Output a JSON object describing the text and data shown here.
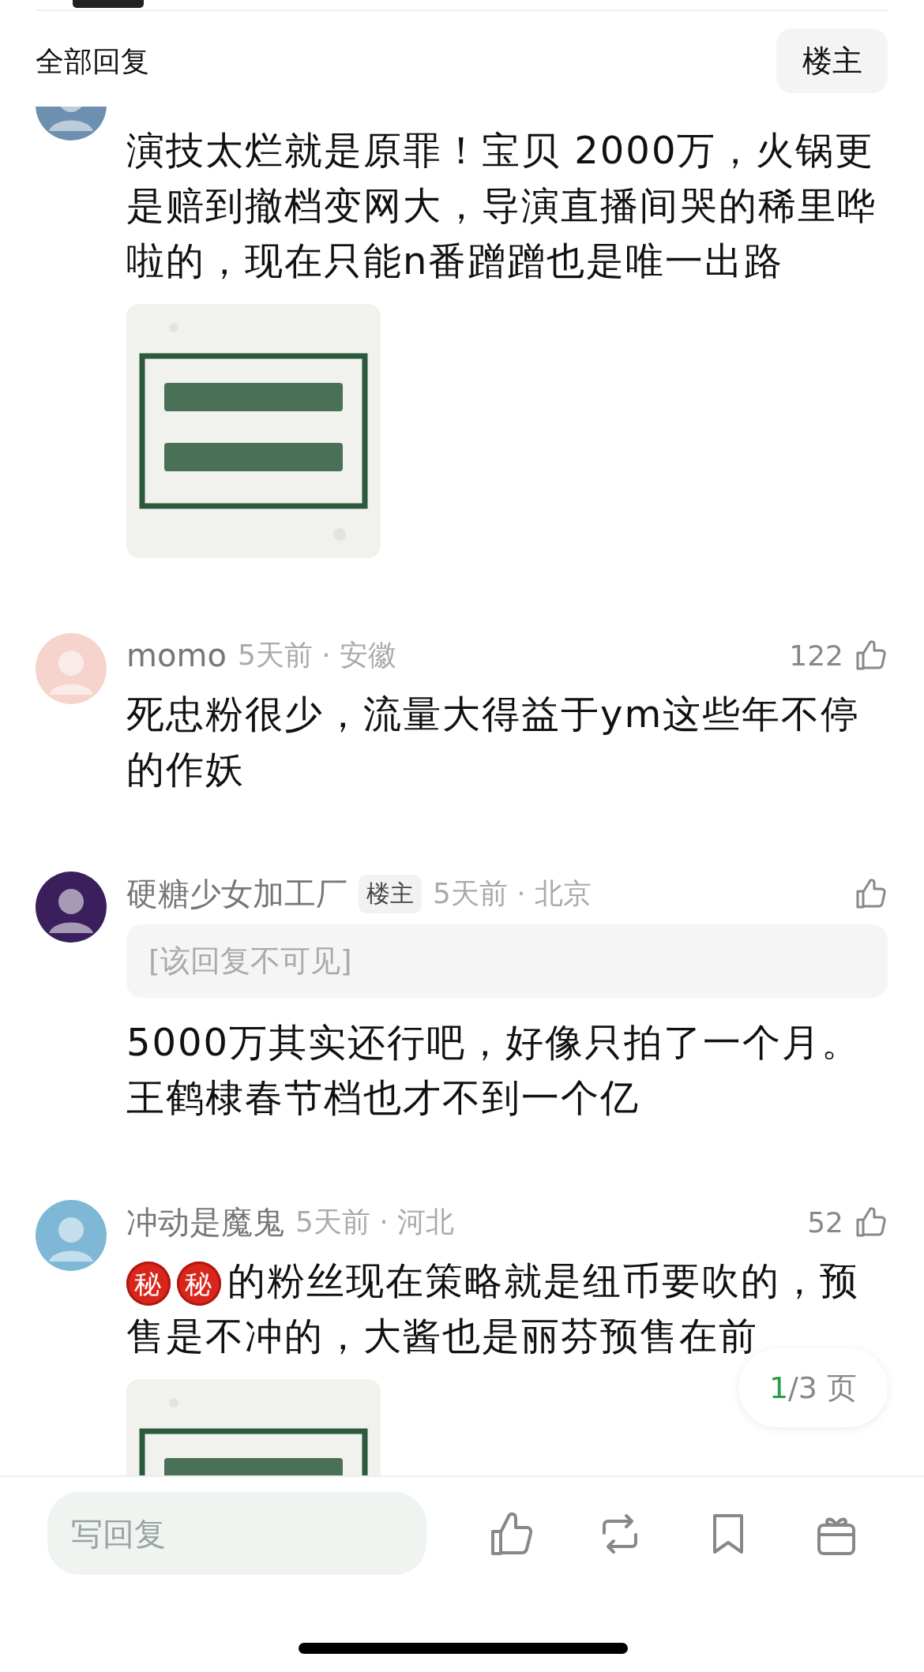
{
  "header": {
    "title": "全部回复",
    "filter_button": "楼主"
  },
  "comments": [
    {
      "body": "演技太烂就是原罪！宝贝 2000万，火锅更是赔到撤档变网大，导演直播间哭的稀里哗啦的，现在只能n番蹭蹭也是唯一出路",
      "color": "#6d8fb0"
    },
    {
      "name": "momo",
      "meta": "5天前 · 安徽",
      "likes": "122",
      "color": "#f6d3cc",
      "body": "死忠粉很少，流量大得益于ym这些年不停的作妖"
    },
    {
      "name": "硬糖少女加工厂",
      "badge": "楼主",
      "meta": "5天前 · 北京",
      "color": "#3a1f5c",
      "hidden_reply": "[该回复不可见]",
      "body": "5000万其实还行吧，好像只拍了一个月。王鹤棣春节档也才不到一个亿"
    },
    {
      "name": "冲动是魔鬼",
      "meta": "5天前 · 河北",
      "likes": "52",
      "color": "#7fb7d6",
      "emoji": [
        "秘",
        "秘"
      ],
      "body": "的粉丝现在策略就是纽币要吹的，预售是不冲的，大酱也是丽芬预售在前"
    }
  ],
  "pager": {
    "current": "1",
    "rest": "/3 页"
  },
  "reply_bar": {
    "placeholder": "写回复"
  }
}
